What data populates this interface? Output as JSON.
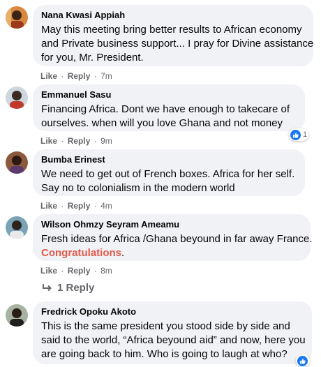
{
  "colors": {
    "bubble": "#f0f2f5",
    "meta_text": "#65676b",
    "highlight": "#e4594a",
    "like_blue": "#1877f2"
  },
  "comments": [
    {
      "author": "Nana Kwasi Appiah",
      "lines": [
        "May this meeting bring better results to African economy",
        "and Private business support... I pray for Divine assistance",
        "for you, Mr. President."
      ],
      "like": "Like",
      "reply": "Reply",
      "time": "7m"
    },
    {
      "author": "Emmanuel Sasu",
      "lines": [
        "Financing Africa. Dont we have enough to takecare of",
        "ourselves. when will you love Ghana and not money"
      ],
      "like": "Like",
      "reply": "Reply",
      "time": "9m",
      "reaction_count": "1",
      "reaction_icon": "thumbs-up-icon"
    },
    {
      "author": "Bumba Erinest",
      "lines": [
        "We need to get out of French boxes. Africa for her self.",
        "Say no to colonialism in the modern world"
      ],
      "like": "Like",
      "reply": "Reply",
      "time": "4m"
    },
    {
      "author": "Wilson Ohmzy Seyram Ameamu",
      "lines": [
        "Fresh ideas for Africa /Ghana beyound in far away France."
      ],
      "highlight": "Congratulations",
      "highlight_suffix": ".",
      "like": "Like",
      "reply": "Reply",
      "time": "8m",
      "replies": "1 Reply",
      "replies_icon": "reply-arrow-icon"
    },
    {
      "author": "Fredrick Opoku Akoto",
      "lines": [
        "This is the same president you stood side by side and",
        "said to the world, “Africa beyound aid” and now, here you",
        "are going back to him. Who is going to laugh at who?"
      ],
      "reaction_icon": "thumbs-up-icon"
    }
  ],
  "separator": "·"
}
